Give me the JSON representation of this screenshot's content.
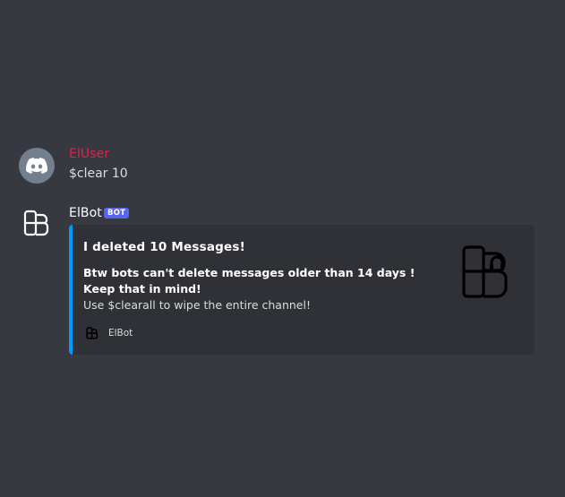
{
  "messages": {
    "user": {
      "username": "ElUser",
      "avatar_icon": "discord-logo-icon",
      "content": "$clear 10"
    },
    "bot": {
      "username": "ElBot",
      "tag": "BOT",
      "avatar_icon": "elbot-logo-icon",
      "embed": {
        "accent_color": "#0099ff",
        "title": "I deleted 10 Messages!",
        "description_bold": "Btw bots can't delete messages older than 14 days ! Keep that in mind!",
        "description": "Use $clearall to wipe the entire channel!",
        "footer_text": "ElBot",
        "footer_icon": "elbot-logo-icon",
        "thumbnail_icon": "elbot-headphones-logo-icon"
      }
    }
  },
  "colors": {
    "background": "#36393f",
    "embed_background": "#2f3136",
    "user_name": "#e91e4b",
    "bot_tag": "#5865f2",
    "discord_avatar": "#747f8d"
  }
}
